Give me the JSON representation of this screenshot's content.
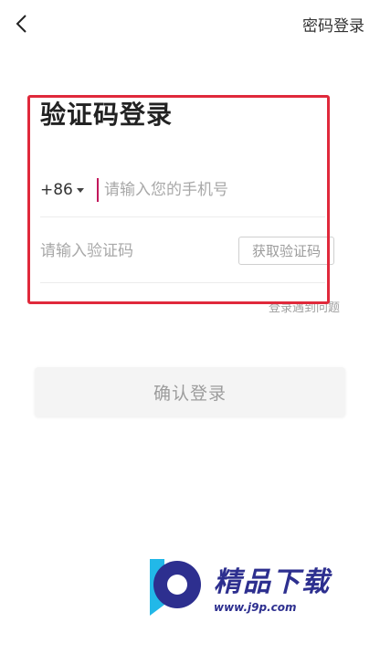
{
  "header": {
    "back_icon": "chevron-left-icon",
    "password_login_label": "密码登录"
  },
  "main": {
    "title": "验证码登录",
    "phone": {
      "country_code": "+86",
      "placeholder": "请输入您的手机号",
      "value": ""
    },
    "code": {
      "placeholder": "请输入验证码",
      "value": "",
      "get_code_label": "获取验证码"
    },
    "help_label": "登录遇到问题",
    "confirm_label": "确认登录"
  },
  "watermark": {
    "title": "精品下载",
    "url": "www.j9p.com"
  },
  "colors": {
    "highlight_border": "#e0293b",
    "cursor": "#c2185b",
    "watermark_blue": "#2d2f8f",
    "watermark_cyan": "#22b8e8"
  }
}
